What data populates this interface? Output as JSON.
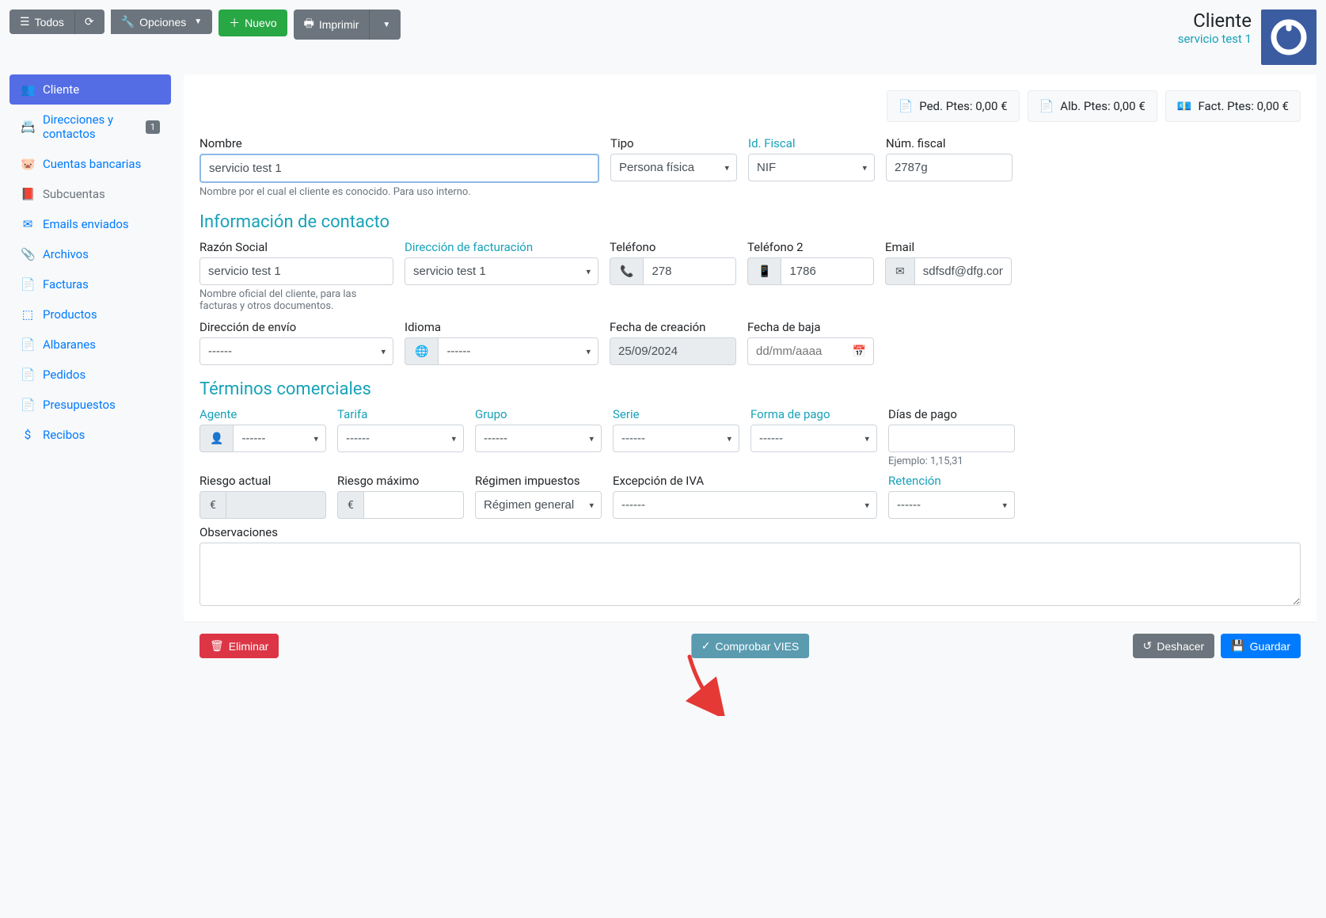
{
  "topbar": {
    "todos": "Todos",
    "opciones": "Opciones",
    "nuevo": "Nuevo",
    "imprimir": "Imprimir",
    "title": "Cliente",
    "subtitle": "servicio test 1"
  },
  "sidebar": {
    "items": [
      {
        "label": "Cliente",
        "active": true,
        "icon": "users"
      },
      {
        "label": "Direcciones y contactos",
        "badge": "1",
        "icon": "address"
      },
      {
        "label": "Cuentas bancarias",
        "icon": "piggy"
      },
      {
        "label": "Subcuentas",
        "icon": "book",
        "muted": true
      },
      {
        "label": "Emails enviados",
        "icon": "mail"
      },
      {
        "label": "Archivos",
        "icon": "clip"
      },
      {
        "label": "Facturas",
        "icon": "copy"
      },
      {
        "label": "Productos",
        "icon": "cubes"
      },
      {
        "label": "Albaranes",
        "icon": "copy"
      },
      {
        "label": "Pedidos",
        "icon": "copy"
      },
      {
        "label": "Presupuestos",
        "icon": "copy"
      },
      {
        "label": "Recibos",
        "icon": "dollar"
      }
    ]
  },
  "status": {
    "ped": "Ped. Ptes: 0,00 €",
    "alb": "Alb. Ptes: 0,00 €",
    "fact": "Fact. Ptes: 0,00 €"
  },
  "form": {
    "nombre_label": "Nombre",
    "nombre_value": "servicio test 1",
    "nombre_help": "Nombre por el cual el cliente es conocido. Para uso interno.",
    "tipo_label": "Tipo",
    "tipo_value": "Persona física",
    "idfiscal_label": "Id. Fiscal",
    "idfiscal_value": "NIF",
    "numfiscal_label": "Núm. fiscal",
    "numfiscal_value": "2787g"
  },
  "contacto": {
    "title": "Información de contacto",
    "razon_label": "Razón Social",
    "razon_value": "servicio test 1",
    "razon_help": "Nombre oficial del cliente, para las facturas y otros documentos.",
    "dir_label": "Dirección de facturación",
    "dir_value": "servicio test 1",
    "tel_label": "Teléfono",
    "tel_value": "278",
    "tel2_label": "Teléfono 2",
    "tel2_value": "1786",
    "email_label": "Email",
    "email_value": "sdfsdf@dfg.com",
    "envio_label": "Dirección de envío",
    "envio_value": "------",
    "idioma_label": "Idioma",
    "idioma_value": "------",
    "fcreacion_label": "Fecha de creación",
    "fcreacion_value": "25/09/2024",
    "fbaja_label": "Fecha de baja",
    "fbaja_placeholder": "dd/mm/aaaa"
  },
  "terminos": {
    "title": "Términos comerciales",
    "agente_label": "Agente",
    "agente_value": "------",
    "tarifa_label": "Tarifa",
    "tarifa_value": "------",
    "grupo_label": "Grupo",
    "grupo_value": "------",
    "serie_label": "Serie",
    "serie_value": "------",
    "fpago_label": "Forma de pago",
    "fpago_value": "------",
    "diaspago_label": "Días de pago",
    "diaspago_help": "Ejemplo: 1,15,31",
    "riesgo_label": "Riesgo actual",
    "riesgomax_label": "Riesgo máximo",
    "regimen_label": "Régimen impuestos",
    "regimen_value": "Régimen general",
    "excepcion_label": "Excepción de IVA",
    "excepcion_value": "------",
    "retencion_label": "Retención",
    "retencion_value": "------",
    "obs_label": "Observaciones"
  },
  "footer": {
    "eliminar": "Eliminar",
    "vies": "Comprobar VIES",
    "deshacer": "Deshacer",
    "guardar": "Guardar"
  }
}
